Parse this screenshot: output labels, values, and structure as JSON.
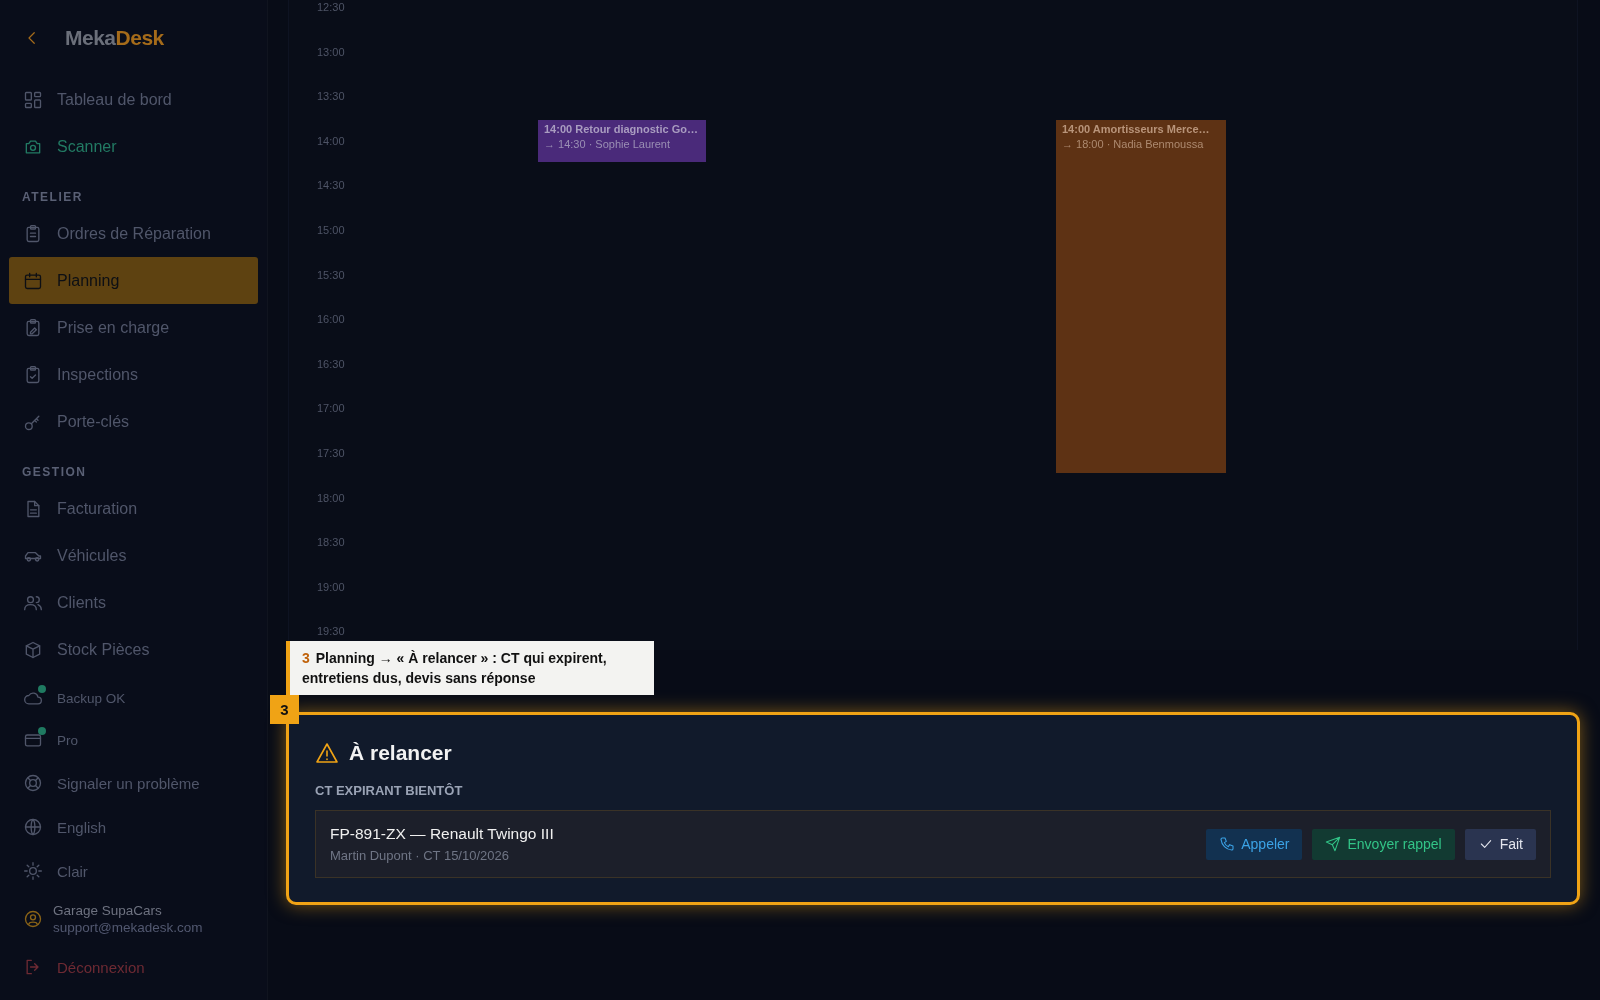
{
  "sidebar": {
    "logo": {
      "first": "Meka",
      "second": "Desk"
    },
    "sections": [
      {
        "items": [
          {
            "label": "Tableau de bord",
            "kind": "nav",
            "selected": false
          },
          {
            "label": "Scanner",
            "kind": "accent",
            "selected": false
          }
        ]
      },
      {
        "title": "ATELIER",
        "items": [
          {
            "label": "Ordres de Réparation",
            "kind": "nav",
            "selected": false
          },
          {
            "label": "Planning",
            "kind": "nav",
            "selected": true
          },
          {
            "label": "Prise en charge",
            "kind": "nav",
            "selected": false
          },
          {
            "label": "Inspections",
            "kind": "nav",
            "selected": false
          },
          {
            "label": "Porte-clés",
            "kind": "nav",
            "selected": false
          }
        ]
      },
      {
        "title": "GESTION",
        "items": [
          {
            "label": "Facturation",
            "kind": "nav",
            "selected": false
          },
          {
            "label": "Véhicules",
            "kind": "nav",
            "selected": false
          },
          {
            "label": "Clients",
            "kind": "nav",
            "selected": false
          },
          {
            "label": "Stock Pièces",
            "kind": "nav",
            "selected": false
          }
        ]
      }
    ],
    "footer": [
      {
        "label": "Backup OK",
        "kind": "status"
      },
      {
        "label": "Pro",
        "kind": "status"
      },
      {
        "label": "Signaler un problème",
        "kind": "nav"
      },
      {
        "label": "English",
        "kind": "nav"
      },
      {
        "label": "Clair",
        "kind": "nav"
      }
    ],
    "account": {
      "name": "Garage SupaCars",
      "email": "support@mekadesk.com"
    },
    "logout": "Déconnexion"
  },
  "calendar": {
    "times": [
      "12:30",
      "13:00",
      "13:30",
      "14:00",
      "14:30",
      "15:00",
      "15:30",
      "16:00",
      "16:30",
      "17:00",
      "17:30",
      "18:00",
      "18:30",
      "19:00",
      "19:30"
    ],
    "events": [
      {
        "title": "14:00 Retour diagnostic Go…",
        "detail": "→ 14:30 · Sophie Laurent",
        "color": "#4a2a7a"
      },
      {
        "title": "14:00 Amortisseurs Merce…",
        "detail": "→ 18:00 · Nadia Benmoussa",
        "color": "#5e3214"
      }
    ]
  },
  "tour": {
    "number": "3",
    "text": "Planning → « À relancer » : CT qui expirent, entretiens dus, devis sans réponse",
    "badge": "3"
  },
  "reminders": {
    "title": "À relancer",
    "section": "CT EXPIRANT BIENTÔT",
    "items": [
      {
        "title": "FP-891-ZX — Renault Twingo III",
        "detail": "Martin Dupont · CT 15/10/2026",
        "actions": [
          {
            "label": "Appeler",
            "kind": "call"
          },
          {
            "label": "Envoyer rappel",
            "kind": "send"
          },
          {
            "label": "Fait",
            "kind": "done"
          }
        ]
      }
    ]
  }
}
